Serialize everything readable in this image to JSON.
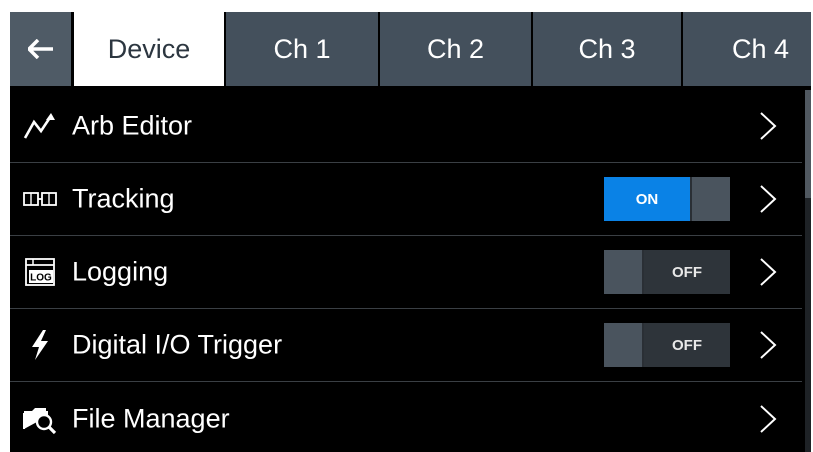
{
  "tabs": {
    "back_icon": "arrow-left-icon",
    "items": [
      {
        "label": "Device",
        "active": true
      },
      {
        "label": "Ch 1",
        "active": false
      },
      {
        "label": "Ch 2",
        "active": false
      },
      {
        "label": "Ch 3",
        "active": false
      },
      {
        "label": "Ch 4",
        "active": false
      }
    ]
  },
  "menu": {
    "items": [
      {
        "label": "Arb Editor",
        "icon": "arb-waveform-icon"
      },
      {
        "label": "Tracking",
        "icon": "tracking-icon",
        "toggle": "ON"
      },
      {
        "label": "Logging",
        "icon": "log-icon",
        "toggle": "OFF",
        "icon_text": "LOG"
      },
      {
        "label": "Digital I/O Trigger",
        "icon": "lightning-bolt-icon",
        "toggle": "OFF"
      },
      {
        "label": "File Manager",
        "icon": "folder-search-icon"
      }
    ]
  },
  "colors": {
    "background": "#000000",
    "tab_inactive": "#44505c",
    "tab_active": "#ffffff",
    "toggle_on": "#0a82e6",
    "separator": "#3a3f44"
  }
}
